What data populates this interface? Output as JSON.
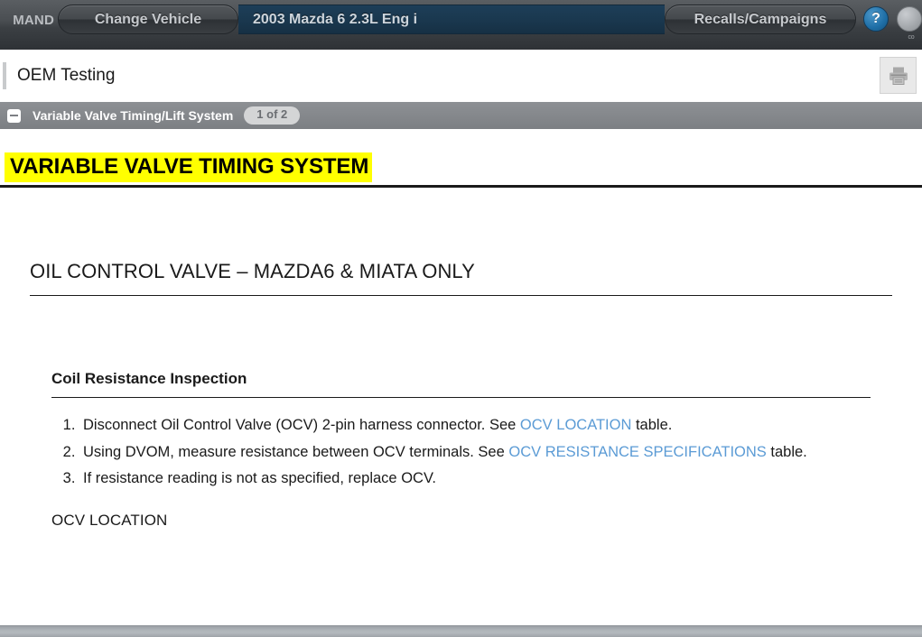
{
  "toolbar": {
    "brand_label": "MAND",
    "change_vehicle_label": "Change Vehicle",
    "vehicle_value": "2003 Mazda 6 2.3L Eng i",
    "recalls_label": "Recalls/Campaigns",
    "help_icon_label": "?",
    "secondary_icon_caption": "co",
    "accent_blue": "#1e6ea6",
    "vehicle_field_bg": "#1a384f"
  },
  "page_strip": {
    "title": "OEM Testing",
    "print_icon_name": "printer-icon"
  },
  "section": {
    "title": "Variable Valve Timing/Lift System",
    "count_badge": "1 of 2",
    "collapse_state": "expanded",
    "bar_bg": "#85888c"
  },
  "document": {
    "highlighted_title": "VARIABLE VALVE TIMING SYSTEM",
    "highlight_color": "#ffff00",
    "heading_2": "OIL CONTROL VALVE – MAZDA6 & MIATA ONLY",
    "heading_3": "Coil Resistance Inspection",
    "steps": [
      {
        "before": "Disconnect Oil Control Valve (OCV) 2-pin harness connector. See ",
        "link": "OCV LOCATION",
        "after": " table."
      },
      {
        "before": "Using DVOM, measure resistance between OCV terminals. See ",
        "link": "OCV RESISTANCE SPECIFICATIONS",
        "after": " table."
      },
      {
        "before": "If resistance reading is not as specified, replace OCV.",
        "link": "",
        "after": ""
      }
    ],
    "subheading": "OCV LOCATION",
    "link_color": "#5b9bd5"
  }
}
